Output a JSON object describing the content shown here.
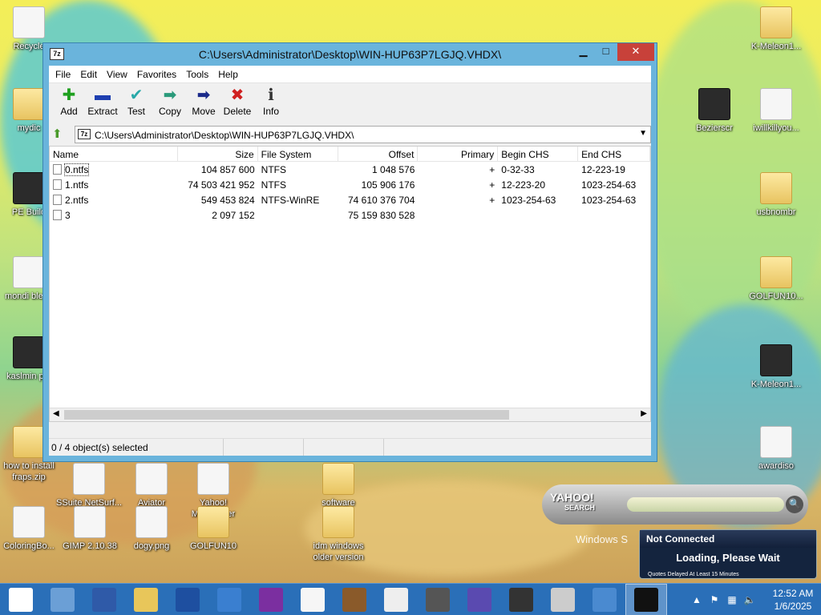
{
  "window": {
    "title": "C:\\Users\\Administrator\\Desktop\\WIN-HUP63P7LGJQ.VHDX\\",
    "logo": "7z",
    "controls": {
      "minimize": "▁",
      "maximize": "□",
      "close": "✕"
    }
  },
  "menu": [
    "File",
    "Edit",
    "View",
    "Favorites",
    "Tools",
    "Help"
  ],
  "toolbar": [
    {
      "label": "Add",
      "icon": "add-icon",
      "glyph": "✚",
      "color": "#1fa01f"
    },
    {
      "label": "Extract",
      "icon": "extract-icon",
      "glyph": "▬",
      "color": "#1e3fb0"
    },
    {
      "label": "Test",
      "icon": "test-icon",
      "glyph": "✔",
      "color": "#28a8a8"
    },
    {
      "label": "Copy",
      "icon": "copy-icon",
      "glyph": "➡",
      "color": "#2a9a7a"
    },
    {
      "label": "Move",
      "icon": "move-icon",
      "glyph": "➡",
      "color": "#1a2a8a"
    },
    {
      "label": "Delete",
      "icon": "delete-icon",
      "glyph": "✖",
      "color": "#d02020"
    },
    {
      "label": "Info",
      "icon": "info-icon",
      "glyph": "ℹ",
      "color": "#333333"
    }
  ],
  "address": {
    "path": "C:\\Users\\Administrator\\Desktop\\WIN-HUP63P7LGJQ.VHDX\\"
  },
  "columns": [
    "Name",
    "Size",
    "File System",
    "Offset",
    "Primary",
    "Begin CHS",
    "End CHS"
  ],
  "rows": [
    {
      "name": "0.ntfs",
      "size": "104 857 600",
      "fs": "NTFS",
      "offset": "1 048 576",
      "primary": "+",
      "begin": "0-32-33",
      "end": "12-223-19"
    },
    {
      "name": "1.ntfs",
      "size": "74 503 421 952",
      "fs": "NTFS",
      "offset": "105 906 176",
      "primary": "+",
      "begin": "12-223-20",
      "end": "1023-254-63"
    },
    {
      "name": "2.ntfs",
      "size": "549 453 824",
      "fs": "NTFS-WinRE",
      "offset": "74 610 376 704",
      "primary": "+",
      "begin": "1023-254-63",
      "end": "1023-254-63"
    },
    {
      "name": "3",
      "size": "2 097 152",
      "fs": "",
      "offset": "75 159 830 528",
      "primary": "",
      "begin": "",
      "end": ""
    }
  ],
  "status": {
    "selection": "0 / 4 object(s) selected"
  },
  "desktop_icons": [
    {
      "label": "Recycle",
      "kind": "file"
    },
    {
      "label": "mydic",
      "kind": "folder"
    },
    {
      "label": "PE Build",
      "kind": "sq-dark"
    },
    {
      "label": "mondi blend",
      "kind": "file"
    },
    {
      "label": "kaslmin pfp",
      "kind": "sq-dark"
    },
    {
      "label": "how to install fraps.zip",
      "kind": "folder"
    },
    {
      "label": "SSuite NetSurf...",
      "kind": "file"
    },
    {
      "label": "Aviator",
      "kind": "file"
    },
    {
      "label": "Yahoo! Messenger",
      "kind": "file"
    },
    {
      "label": "software",
      "kind": "folder"
    },
    {
      "label": "K-Meleon1...",
      "kind": "folder"
    },
    {
      "label": "Bezierscr",
      "kind": "sq-dark"
    },
    {
      "label": "iwillkillyou...",
      "kind": "file"
    },
    {
      "label": "usbnombr",
      "kind": "folder"
    },
    {
      "label": "GOLFUN10...",
      "kind": "folder"
    },
    {
      "label": "K-Meleon1...",
      "kind": "sq-dark"
    },
    {
      "label": "awardiso",
      "kind": "file"
    },
    {
      "label": "ColoringBo...",
      "kind": "file"
    },
    {
      "label": "GIMP 2.10.38",
      "kind": "file"
    },
    {
      "label": "dogy.png",
      "kind": "file"
    },
    {
      "label": "GOLFUN10",
      "kind": "folder"
    },
    {
      "label": "idm windows older version",
      "kind": "folder"
    }
  ],
  "yahoo": {
    "brand": "YAHOO!",
    "sub": "SEARCH",
    "go": "🔍",
    "under": "Windows S"
  },
  "ticker": {
    "status": "Not Connected",
    "message": "Loading, Please Wait",
    "note": "Quotes Delayed At Least 15 Minutes"
  },
  "taskbar": {
    "apps": [
      "start",
      "explorer-app",
      "powershell",
      "file-explorer",
      "app-a",
      "refresh-app",
      "yahoo-app",
      "notepad",
      "box-app",
      "camera-app",
      "gimp",
      "gear-app",
      "monitor-app",
      "scanner-app",
      "globe-app",
      "7zip-app"
    ],
    "clock_time": "12:52 AM",
    "clock_date": "1/6/2025"
  }
}
